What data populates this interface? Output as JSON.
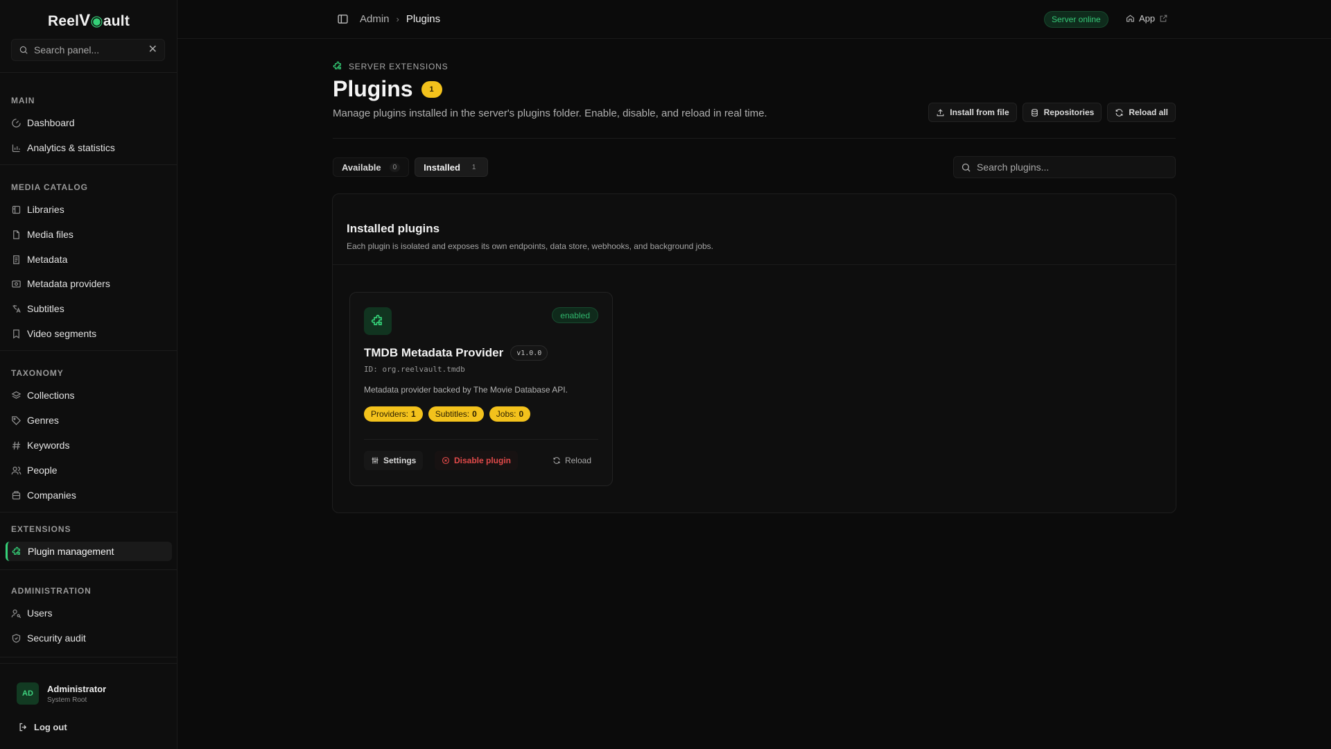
{
  "brand": {
    "part1": "Reel",
    "v": "V",
    "part2": "ault"
  },
  "sidebar": {
    "search": {
      "placeholder": "Search panel..."
    },
    "sections": [
      {
        "title": "MAIN",
        "items": [
          {
            "label": "Dashboard",
            "icon": "gauge-icon"
          },
          {
            "label": "Analytics & statistics",
            "icon": "bar-chart-icon"
          }
        ]
      },
      {
        "title": "MEDIA CATALOG",
        "items": [
          {
            "label": "Libraries",
            "icon": "library-icon"
          },
          {
            "label": "Media files",
            "icon": "file-icon"
          },
          {
            "label": "Metadata",
            "icon": "document-icon"
          },
          {
            "label": "Metadata providers",
            "icon": "provider-icon"
          },
          {
            "label": "Subtitles",
            "icon": "translate-icon"
          },
          {
            "label": "Video segments",
            "icon": "bookmark-icon"
          }
        ]
      },
      {
        "title": "TAXONOMY",
        "items": [
          {
            "label": "Collections",
            "icon": "layers-icon"
          },
          {
            "label": "Genres",
            "icon": "tag-icon"
          },
          {
            "label": "Keywords",
            "icon": "hash-icon"
          },
          {
            "label": "People",
            "icon": "users-icon"
          },
          {
            "label": "Companies",
            "icon": "building-icon"
          }
        ]
      },
      {
        "title": "EXTENSIONS",
        "items": [
          {
            "label": "Plugin management",
            "icon": "puzzle-icon",
            "active": true
          }
        ]
      },
      {
        "title": "ADMINISTRATION",
        "items": [
          {
            "label": "Users",
            "icon": "user-key-icon"
          },
          {
            "label": "Security audit",
            "icon": "shield-icon"
          }
        ]
      }
    ],
    "user": {
      "initials": "AD",
      "name": "Administrator",
      "role": "System Root"
    },
    "logout_label": "Log out"
  },
  "topbar": {
    "breadcrumb": [
      "Admin",
      "Plugins"
    ],
    "server_status": "Server online",
    "app_link": "App"
  },
  "page": {
    "eyebrow": "SERVER EXTENSIONS",
    "title": "Plugins",
    "title_count": "1",
    "description": "Manage plugins installed in the server's plugins folder. Enable, disable, and reload in real time.",
    "actions": {
      "install": "Install from file",
      "repositories": "Repositories",
      "reload_all": "Reload all"
    },
    "tabs": [
      {
        "label": "Available",
        "count": "0"
      },
      {
        "label": "Installed",
        "count": "1",
        "active": true
      }
    ],
    "search": {
      "placeholder": "Search plugins..."
    }
  },
  "panel": {
    "title": "Installed plugins",
    "subtitle": "Each plugin is isolated and exposes its own endpoints, data store, webhooks, and background jobs."
  },
  "plugin": {
    "name": "TMDB Metadata Provider",
    "version": "v1.0.0",
    "id": "ID: org.reelvault.tmdb",
    "description": "Metadata provider backed by The Movie Database API.",
    "status": "enabled",
    "chips": [
      {
        "label": "Providers:",
        "value": "1"
      },
      {
        "label": "Subtitles:",
        "value": "0"
      },
      {
        "label": "Jobs:",
        "value": "0"
      }
    ],
    "actions": {
      "settings": "Settings",
      "disable": "Disable plugin",
      "reload": "Reload"
    }
  },
  "colors": {
    "accent": "#35d178",
    "badge": "#f3c21c",
    "danger": "#e24a4a",
    "background": "#0b0b0b"
  }
}
